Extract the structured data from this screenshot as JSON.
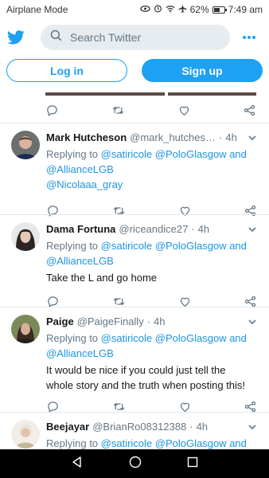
{
  "status_bar": {
    "mode": "Airplane Mode",
    "battery": "62%",
    "battery_level": 0.62,
    "time": "7:49 am"
  },
  "header": {
    "search_placeholder": "Search Twitter"
  },
  "auth": {
    "login_label": "Log in",
    "signup_label": "Sign up"
  },
  "tweets": [
    {
      "name": "Mark Hutcheson",
      "handle": "@mark_hutches…",
      "time": "4h",
      "replying_prefix": "Replying to ",
      "mention1": "@satiricole",
      "mention2": "@PoloGlasgow",
      "and": " and",
      "mention3": "@AllianceLGB",
      "mention4": "@Nicolaaa_gray",
      "text": ""
    },
    {
      "name": "Dama Fortuna",
      "handle": "@riceandice27",
      "time": "4h",
      "replying_prefix": "Replying to ",
      "mention1": "@satiricole",
      "mention2": "@PoloGlasgow",
      "and": " and",
      "mention3": "@AllianceLGB",
      "text": "Take the L and go home"
    },
    {
      "name": "Paige",
      "handle": "@PaigeFinally",
      "time": "4h",
      "replying_prefix": "Replying to ",
      "mention1": "@satiricole",
      "mention2": "@PoloGlasgow",
      "and": " and",
      "mention3": "@AllianceLGB",
      "text_line1": "It would be nice if you could just tell the",
      "text_line2": "whole story and the truth when posting this!"
    },
    {
      "name": "Beejayar",
      "handle": "@BrianRo08312388",
      "time": "4h",
      "replying_prefix": "Replying to ",
      "mention1": "@satiricole",
      "mention2": "@PoloGlasgow",
      "and": " and"
    }
  ],
  "colors": {
    "accent": "#1da1f2",
    "mention": "#1b95e0",
    "muted": "#657786",
    "divider": "#e1e8ed"
  },
  "icons": [
    "airplane-icon",
    "eye-icon",
    "alarm-icon",
    "wifi-icon",
    "battery-icon",
    "twitter-logo-icon",
    "search-icon",
    "more-icon",
    "reply-icon",
    "retweet-icon",
    "like-icon",
    "share-icon",
    "chevron-down-icon",
    "back-icon",
    "home-icon",
    "recents-icon"
  ]
}
